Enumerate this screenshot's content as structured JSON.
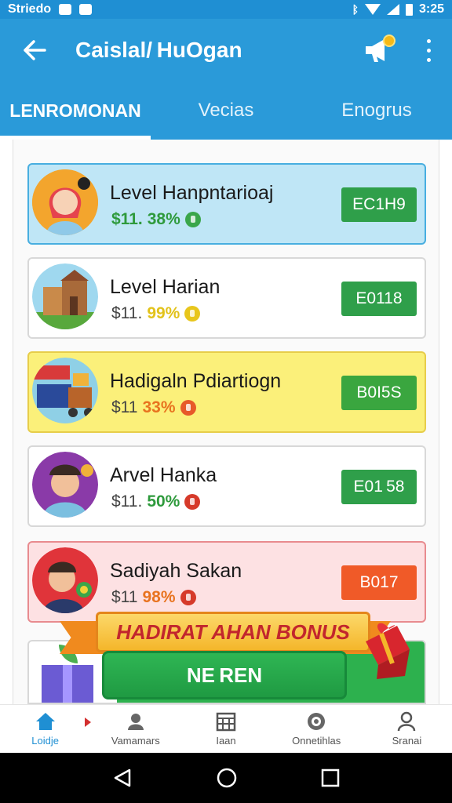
{
  "status_bar": {
    "app_name": "Striedo",
    "time": "3:25"
  },
  "app_bar": {
    "title": "Caislal/ HuOgan"
  },
  "tabs": [
    {
      "label": "LENROMONAN",
      "active": true
    },
    {
      "label": "Vecias",
      "active": false
    },
    {
      "label": "Enogrus",
      "active": false
    }
  ],
  "cards": [
    {
      "title": "Level Hanpntarioaj",
      "price": "$11.",
      "percent": "38%",
      "percent_color": "#2e9a3c",
      "coin_color": "#3aa64a",
      "button": "EC1H9",
      "button_color": "#2f9f4a",
      "style": "blue",
      "avatar": "girl-avatar"
    },
    {
      "title": "Level Harian",
      "price": "$11.",
      "percent": "99%",
      "percent_color": "#e2c21a",
      "coin_color": "#e8c61c",
      "button": "E0118",
      "button_color": "#2f9f4a",
      "style": "white",
      "avatar": "building-avatar"
    },
    {
      "title": "Hadigaln Pdiartiogn",
      "price": "$11",
      "percent": "33%",
      "percent_color": "#e8731f",
      "coin_color": "#e7592a",
      "button": "B0I5S",
      "button_color": "#3aa63f",
      "style": "yellow",
      "avatar": "cart-avatar"
    },
    {
      "title": "Arvel Hanka",
      "price": "$11.",
      "percent": "50%",
      "percent_color": "#2e9a3c",
      "coin_color": "#d63a2a",
      "button": "E01 58",
      "button_color": "#2f9f4a",
      "style": "white",
      "avatar": "man-avatar"
    },
    {
      "title": "Sadiyah Sakan",
      "price": "$11",
      "percent": "98%",
      "percent_color": "#e8731f",
      "coin_color": "#d63a2a",
      "button": "B017",
      "button_color": "#f05a28",
      "style": "pink",
      "avatar": "boy-avatar"
    }
  ],
  "promo": {
    "banner": "HADIRAT AHAN BONUS",
    "button": "NE REN"
  },
  "bottom_nav": [
    {
      "label": "Loidje",
      "icon": "home-icon",
      "active": true
    },
    {
      "label": "Vamamars",
      "icon": "person-icon",
      "active": false
    },
    {
      "label": "Iaan",
      "icon": "calendar-icon",
      "active": false
    },
    {
      "label": "Onnetihlas",
      "icon": "clock-icon",
      "active": false
    },
    {
      "label": "Sranai",
      "icon": "profile-icon",
      "active": false
    }
  ]
}
